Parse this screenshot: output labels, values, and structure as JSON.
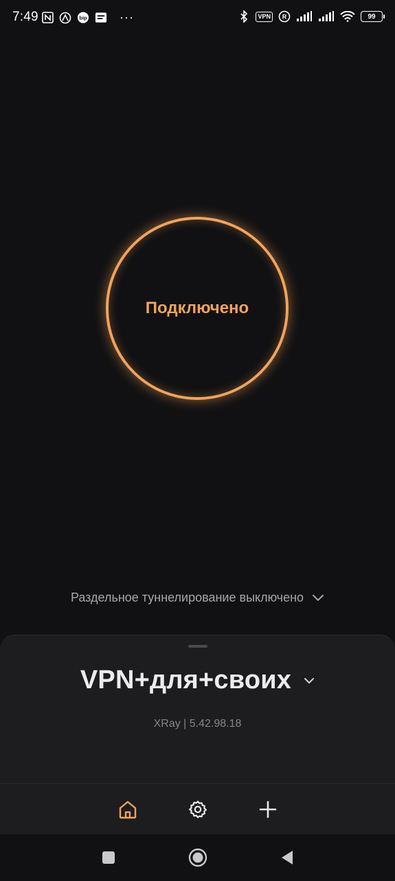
{
  "status_bar": {
    "time": "7:49",
    "left_icons": [
      "nfc-icon",
      "notification-app-icon",
      "bip-icon",
      "mail-icon"
    ],
    "more": "···",
    "right_icons": [
      "bluetooth-icon",
      "vpn-icon",
      "registered-icon",
      "signal-icon",
      "signal-icon",
      "wifi-icon",
      "battery-icon"
    ],
    "vpn_badge": "VPN",
    "battery_level": "99"
  },
  "connection": {
    "status_label": "Подключено",
    "accent_color": "#f3a35a"
  },
  "split_tunneling": {
    "label": "Раздельное туннелирование выключено"
  },
  "server": {
    "name": "VPN+для+своих",
    "protocol_info": "XRay | 5.42.98.18"
  },
  "tabs": [
    {
      "name": "home",
      "icon": "home-icon",
      "active": true
    },
    {
      "name": "settings",
      "icon": "gear-icon",
      "active": false
    },
    {
      "name": "add",
      "icon": "plus-icon",
      "active": false
    }
  ],
  "nav": [
    "recent-apps",
    "home",
    "back"
  ]
}
